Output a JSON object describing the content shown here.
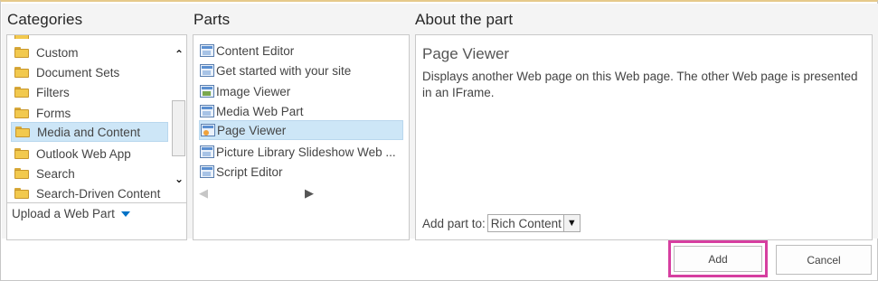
{
  "headings": {
    "categories": "Categories",
    "parts": "Parts",
    "about": "About the part"
  },
  "categories": {
    "items": [
      {
        "label": "Custom",
        "selected": false
      },
      {
        "label": "Document Sets",
        "selected": false
      },
      {
        "label": "Filters",
        "selected": false
      },
      {
        "label": "Forms",
        "selected": false
      },
      {
        "label": "Media and Content",
        "selected": true
      },
      {
        "label": "Outlook Web App",
        "selected": false
      },
      {
        "label": "Search",
        "selected": false
      },
      {
        "label": "Search-Driven Content",
        "selected": false
      }
    ],
    "upload_label": "Upload a Web Part",
    "scroll_up_glyph": "⌃",
    "scroll_down_glyph": "⌄"
  },
  "parts": {
    "items": [
      {
        "label": "Content Editor",
        "icon": "content-editor-icon",
        "selected": false
      },
      {
        "label": "Get started with your site",
        "icon": "get-started-icon",
        "selected": false
      },
      {
        "label": "Image Viewer",
        "icon": "image-viewer-icon",
        "selected": false
      },
      {
        "label": "Media Web Part",
        "icon": "media-web-part-icon",
        "selected": false
      },
      {
        "label": "Page Viewer",
        "icon": "page-viewer-icon",
        "selected": true
      },
      {
        "label": "Picture Library Slideshow Web ...",
        "icon": "slideshow-icon",
        "selected": false
      },
      {
        "label": "Script Editor",
        "icon": "script-editor-icon",
        "selected": false
      }
    ],
    "prev_glyph": "◀",
    "next_glyph": "▶"
  },
  "about": {
    "title": "Page Viewer",
    "description": "Displays another Web page on this Web page. The other Web page is presented in an IFrame.",
    "add_to_label": "Add part to:",
    "zone_value": "Rich Content",
    "zone_arrow": "▼"
  },
  "buttons": {
    "add": "Add",
    "cancel": "Cancel"
  },
  "colors": {
    "selection": "#cde6f7",
    "highlight_border": "#d63fa0",
    "link_caret": "#0072c6"
  }
}
